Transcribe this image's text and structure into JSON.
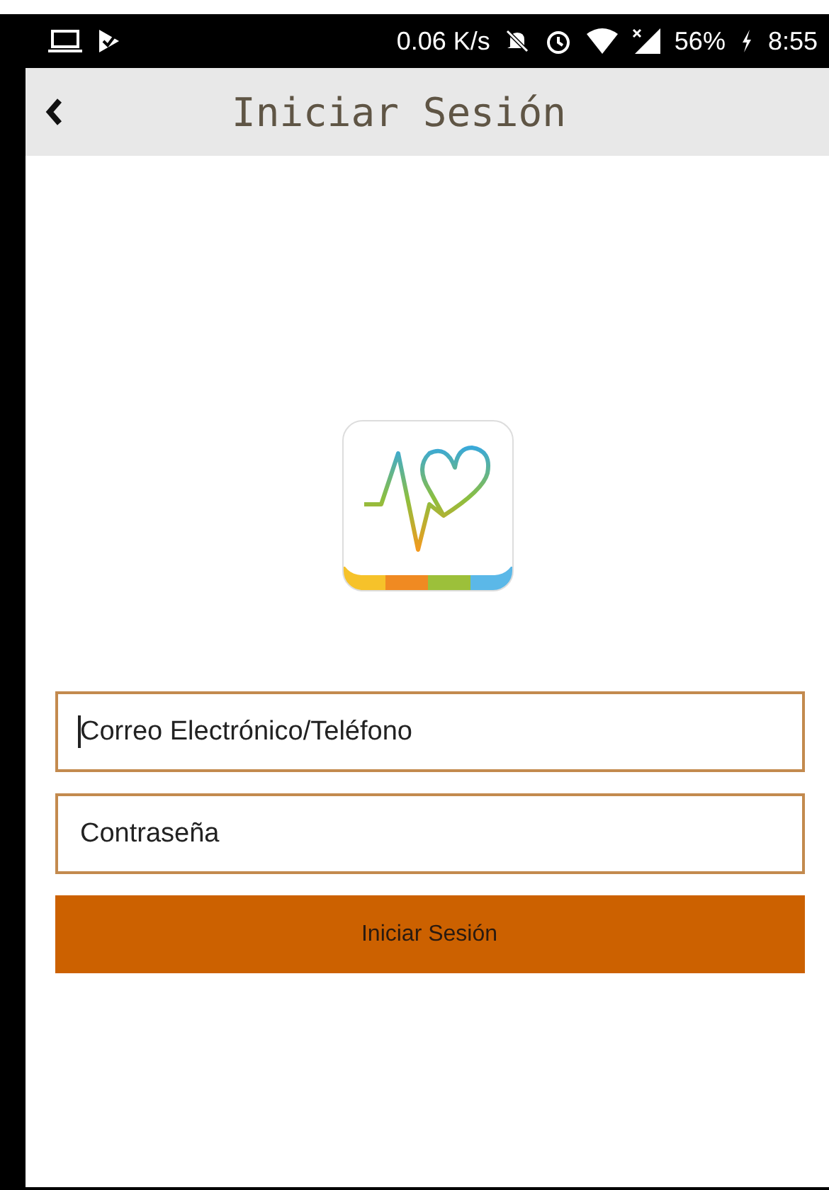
{
  "status_bar": {
    "speed": "0.06 K/s",
    "battery": "56%",
    "time": "8:55"
  },
  "app_bar": {
    "title": "Iniciar Sesión"
  },
  "fields": [
    {
      "placeholder": "Correo Electrónico/Teléfono",
      "focused": true
    },
    {
      "placeholder": "Contraseña",
      "focused": false
    }
  ],
  "button": {
    "label": "Iniciar Sesión"
  }
}
